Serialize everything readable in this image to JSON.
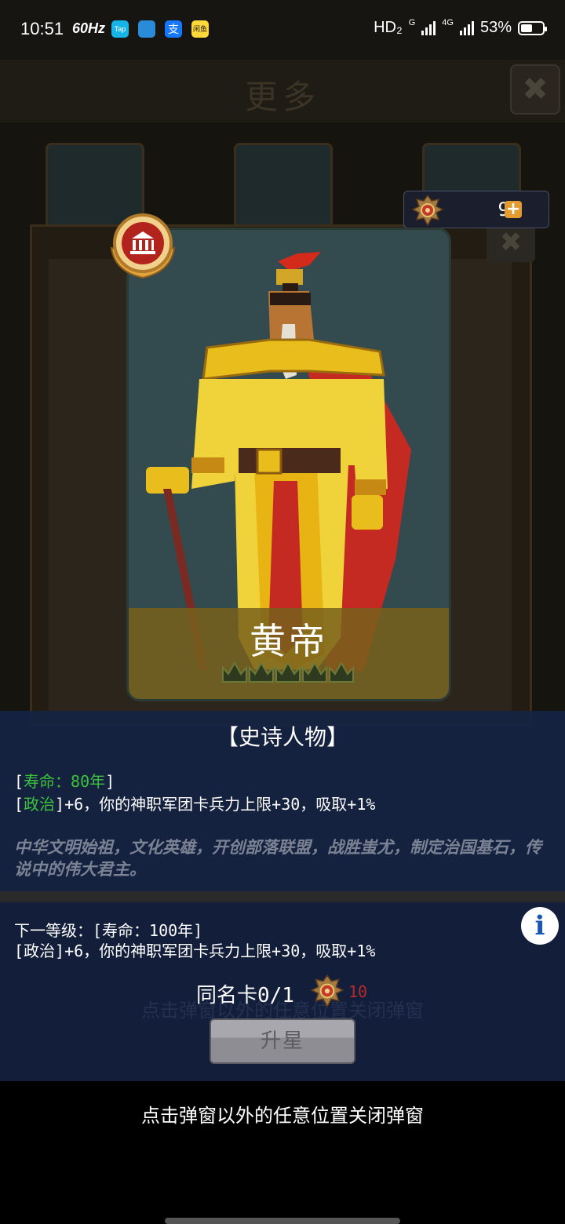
{
  "status_bar": {
    "time": "10:51",
    "refresh": "60Hz",
    "apps": [
      "Tap",
      "",
      "支",
      "闲鱼"
    ],
    "network": "HD₂",
    "signal_1": "G",
    "signal_2": "4G",
    "battery": "53%",
    "battery_level": 0.53
  },
  "background": {
    "title": "更多",
    "close_icon": "close-icon"
  },
  "currency": {
    "count": "9",
    "plus": "+",
    "icon": "eagle-emblem-icon"
  },
  "card": {
    "name": "黄帝",
    "badge_icon": "museum-laurel-badge-icon",
    "stars": 5,
    "colors": {
      "band": "#7a6220",
      "bg": "#334a4e"
    }
  },
  "info": {
    "rarity": "【史诗人物】",
    "lifespan_open": "[",
    "lifespan": "寿命：80年",
    "lifespan_close": "]",
    "politics_open": "[",
    "politics": "政治",
    "politics_effect": "]+6，你的神职军团卡兵力上限+30，吸取+1%",
    "description": "中华文明始祖，文化英雄，开创部落联盟，战胜蚩尤，制定治国基石，传说中的伟大君主。"
  },
  "next_level": {
    "line1": "下一等级：[寿命：100年]",
    "line2": "[政治]+6，你的神职军团卡兵力上限+30，吸取+1%",
    "info_icon": "i"
  },
  "duplicate": {
    "label": "同名卡0/1",
    "cost": "10"
  },
  "upgrade_button": "升星",
  "ghost_hint": "点击弹窗以外的任意位置关闭弹窗",
  "close_hint": "点击弹窗以外的任意位置关闭弹窗"
}
